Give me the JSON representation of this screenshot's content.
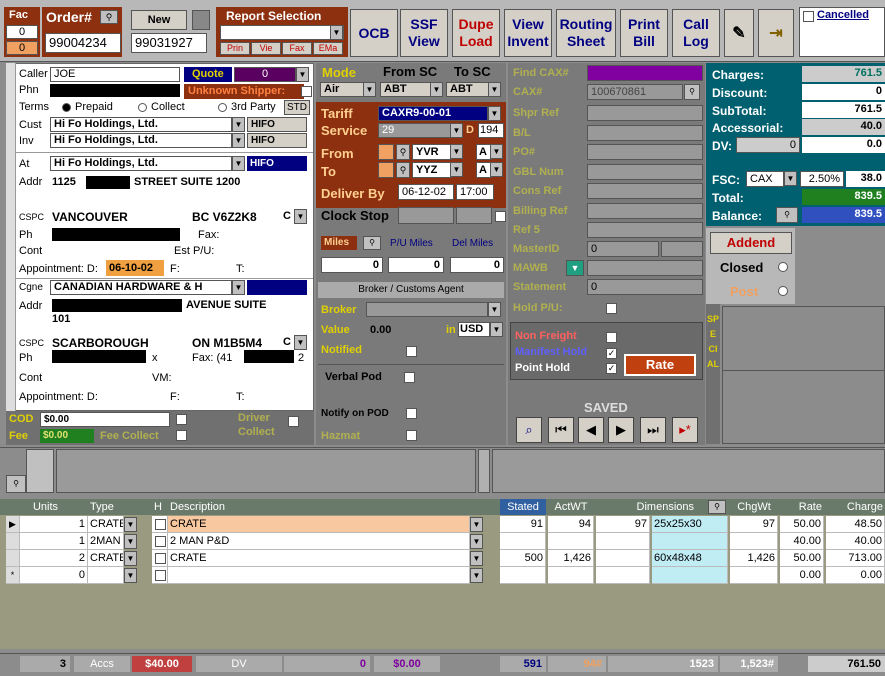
{
  "toolbar": {
    "fac_label": "Fac",
    "fac_value_top": "0",
    "fac_value_bottom": "0",
    "order_label": "Order#",
    "order_value": "99004234",
    "new_label": "New",
    "new_value": "99031927",
    "report_title": "Report Selection",
    "report_btns": [
      "Prin",
      "Vie",
      "Fax",
      "EMa"
    ],
    "ocb": "OCB",
    "buttons": [
      {
        "l1": "SSF",
        "l2": "View",
        "color": "#000080"
      },
      {
        "l1": "Dupe",
        "l2": "Load",
        "color": "#c00000"
      },
      {
        "l1": "View",
        "l2": "Invent",
        "color": "#000080"
      },
      {
        "l1": "Routing",
        "l2": "Sheet",
        "color": "#000080"
      },
      {
        "l1": "Print",
        "l2": "Bill",
        "color": "#000080"
      },
      {
        "l1": "Call",
        "l2": "Log",
        "color": "#000080"
      }
    ],
    "cancelled": "Cancelled"
  },
  "shipper": {
    "caller_label": "Caller",
    "caller_value": "JOE",
    "quote_label": "Quote",
    "quote_value": "0",
    "phn_label": "Phn",
    "unknown_shipper": "Unknown Shipper:",
    "terms_label": "Terms",
    "terms": [
      "Prepaid",
      "Collect",
      "3rd Party"
    ],
    "std": "STD",
    "cust_label": "Cust",
    "cust_value": "Hi Fo Holdings, Ltd.",
    "cust_btn": "HIFO",
    "inv_label": "Inv",
    "inv_value": "Hi Fo Holdings, Ltd.",
    "inv_btn": "HIFO",
    "at_label": "At",
    "at_value": "Hi Fo Holdings, Ltd.",
    "at_code": "HIFO",
    "addr_label": "Addr",
    "addr_num": "1125",
    "addr_rest": "STREET SUITE 1200",
    "cspc_label": "CSPC",
    "city": "VANCOUVER",
    "prov": "BC V6Z2K8",
    "c_label": "C",
    "ph_label": "Ph",
    "fax_label": "Fax:",
    "cont_label": "Cont",
    "estpu_label": "Est P/U:",
    "appt_label": "Appointment: D:",
    "appt_date": "06-10-02",
    "appt_f": "F:",
    "appt_t": "T:"
  },
  "consignee": {
    "cgne_label": "Cgne",
    "cgne_value": "CANADIAN HARDWARE & H",
    "addr_label": "Addr",
    "addr_rest": "AVENUE SUITE",
    "addr_line2": "101",
    "cspc_label": "CSPC",
    "city": "SCARBOROUGH",
    "prov": "ON M1B5M4",
    "c_label": "C",
    "ph_label": "Ph",
    "ph_suffix": "x",
    "fax_label": "Fax: (41",
    "fax_suffix": "2",
    "cont_label": "Cont",
    "vm_label": "VM:",
    "appt_label": "Appointment: D:",
    "appt_f": "F:",
    "appt_t": "T:"
  },
  "cod": {
    "cod_label": "COD",
    "cod_value": "$0.00",
    "fee_label": "Fee",
    "fee_value": "$0.00",
    "fee_collect": "Fee Collect",
    "driver_collect_1": "Driver",
    "driver_collect_2": "Collect"
  },
  "mode": {
    "mode_label": "Mode",
    "from_sc": "From SC",
    "to_sc": "To SC",
    "mode_value": "Air",
    "from_value": "ABT",
    "to_value": "ABT",
    "tariff_label": "Tariff",
    "tariff_value": "CAXR9-00-01",
    "service_label": "Service",
    "service_value": "29",
    "service_d": "D",
    "service_num": "194",
    "from_label": "From",
    "from_city": "YVR",
    "from_a": "A",
    "to_label": "To",
    "to_city": "YYZ",
    "to_a": "A",
    "deliver_by_label": "Deliver By",
    "deliver_date": "06-12-02",
    "deliver_time": "17:00",
    "clock_stop_label": "Clock Stop",
    "miles_label": "Miles",
    "pu_miles": "P/U Miles",
    "del_miles": "Del Miles",
    "miles_val": "0",
    "pu_val": "0",
    "del_val": "0",
    "broker_title": "Broker / Customs Agent",
    "broker_label": "Broker",
    "value_label": "Value",
    "value_val": "0.00",
    "in_label": "in",
    "currency": "USD",
    "notified_label": "Notified",
    "verbal_pod": "Verbal Pod",
    "notify_pod": "Notify on POD",
    "hazmat": "Hazmat"
  },
  "refs": {
    "find_cax": "Find CAX#",
    "cax_label": "CAX#",
    "cax_value": "100670861",
    "labels": [
      "Shpr Ref",
      "B/L",
      "PO#",
      "GBL Num",
      "Cons Ref",
      "Billing Ref",
      "Ref 5"
    ],
    "master_id": "MasterID",
    "master_val": "0",
    "mawb": "MAWB",
    "statement": "Statement",
    "statement_val": "0",
    "hold_pu": "Hold P/U:",
    "non_freight": "Non Freight",
    "manifest_hold": "Manifest Hold",
    "point_hold": "Point Hold",
    "rate_btn": "Rate",
    "saved": "SAVED"
  },
  "charges": {
    "rows": [
      {
        "label": "Charges:",
        "value": "761.5"
      },
      {
        "label": "Discount:",
        "value": "0"
      },
      {
        "label": "SubTotal:",
        "value": "761.5"
      },
      {
        "label": "Accessorial:",
        "value": "40.0"
      },
      {
        "label": "DV:",
        "dv_value": "0",
        "value": "0.0"
      }
    ],
    "fsc_label": "FSC:",
    "fsc_code": "CAX",
    "fsc_pct": "2.50%",
    "fsc_value": "38.0",
    "total_label": "Total:",
    "total_value": "839.5",
    "balance_label": "Balance:",
    "balance_value": "839.5",
    "addend": "Addend",
    "closed": "Closed",
    "post": "Post",
    "special": "SPECIAL"
  },
  "grid": {
    "headers": [
      "Units",
      "Type",
      "H",
      "Description",
      "Stated",
      "ActWT",
      "Dimensions",
      "ChgWt",
      "Rate",
      "Charge"
    ],
    "rows": [
      {
        "marker": "▶",
        "units": "1",
        "type": "CRATE",
        "desc": "CRATE",
        "stated": "91",
        "actwt": "94",
        "dims_n": "97",
        "dims": "25x25x30",
        "chgwt": "97",
        "rate": "50.00",
        "charge": "48.50",
        "highlight": true
      },
      {
        "marker": "",
        "units": "1",
        "type": "2MAN",
        "desc": "2 MAN P&D",
        "stated": "",
        "actwt": "",
        "dims_n": "",
        "dims": "",
        "chgwt": "",
        "rate": "40.00",
        "charge": "40.00",
        "highlight": false
      },
      {
        "marker": "",
        "units": "2",
        "type": "CRATE",
        "desc": "CRATE",
        "stated": "500",
        "actwt": "1,426",
        "dims_n": "",
        "dims": "60x48x48",
        "chgwt": "1,426",
        "rate": "50.00",
        "charge": "713.00",
        "highlight": false
      },
      {
        "marker": "*",
        "units": "0",
        "type": "",
        "desc": "",
        "stated": "",
        "actwt": "",
        "dims_n": "",
        "dims": "",
        "chgwt": "",
        "rate": "0.00",
        "charge": "0.00",
        "highlight": false
      }
    ]
  },
  "footer": {
    "units": "3",
    "accs_label": "Accs",
    "accs_val": "$40.00",
    "dv_label": "DV",
    "dv_val": "0",
    "dv_amt": "$0.00",
    "stated": "591",
    "actwt": "94#",
    "dims": "1523",
    "chgwt": "1,523#",
    "total": "761.50"
  }
}
